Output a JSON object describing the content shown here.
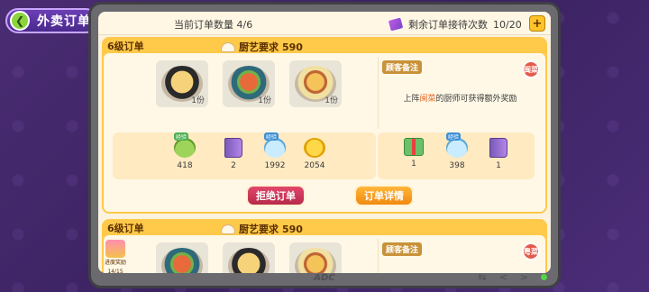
{
  "header": {
    "title": "外卖订单",
    "back_icon": "back-arrow-icon"
  },
  "topbar": {
    "order_count_label": "当前订单数量",
    "order_count_value": "4/6",
    "remaining_label": "剩余订单接待次数",
    "remaining_value": "10/20",
    "plus_label": "+"
  },
  "orders": [
    {
      "level": "6级订单",
      "skill_label": "厨艺要求",
      "skill_value": "590",
      "dishes": [
        {
          "qty": "1份",
          "icon": "tofu-bowl-icon"
        },
        {
          "qty": "1份",
          "icon": "seafood-bowl-icon"
        },
        {
          "qty": "1份",
          "icon": "shrimp-bowl-icon"
        }
      ],
      "rewards": [
        {
          "icon": "exp-green-icon",
          "tag": "经验",
          "value": "418"
        },
        {
          "icon": "book-icon",
          "value": "2"
        },
        {
          "icon": "exp-blue-icon",
          "tag": "经验",
          "value": "1992"
        },
        {
          "icon": "coin-icon",
          "value": "2054"
        }
      ],
      "note": {
        "title": "顾客备注",
        "text_before": "上阵",
        "text_highlight": "闽菜",
        "text_after": "的厨师可获得额外奖励",
        "cuisine_badge": "闽菜"
      },
      "bonus_rewards": [
        {
          "icon": "gift-icon",
          "value": "1"
        },
        {
          "icon": "exp-blue-icon",
          "tag": "经验",
          "value": "398"
        },
        {
          "icon": "book-icon",
          "value": "1"
        }
      ],
      "reject_label": "拒绝订单",
      "detail_label": "订单详情"
    },
    {
      "level": "6级订单",
      "skill_label": "厨艺要求",
      "skill_value": "590",
      "note": {
        "title": "顾客备注",
        "cuisine_badge": "粤菜"
      }
    }
  ],
  "side_progress": {
    "label": "进度奖励",
    "value": "14/15"
  },
  "footer": {
    "brand": "ADC"
  }
}
